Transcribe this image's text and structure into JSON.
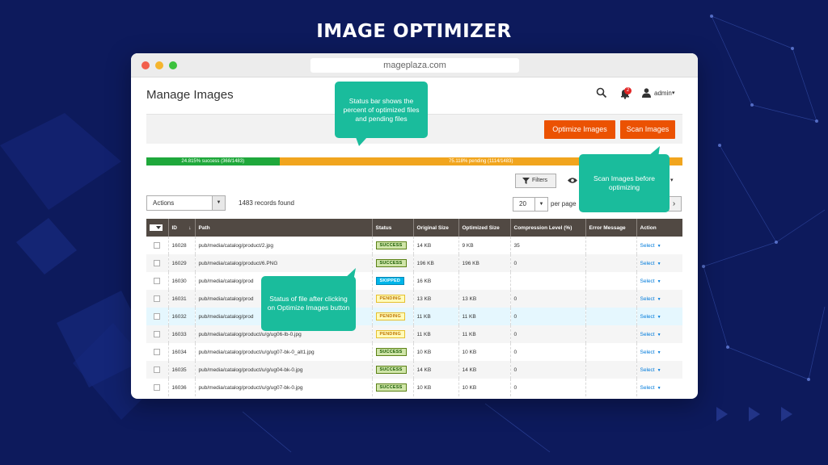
{
  "banner": {
    "title": "IMAGE OPTIMIZER"
  },
  "browser": {
    "url": "mageplaza.com"
  },
  "page": {
    "title": "Manage Images"
  },
  "header": {
    "notification_count": "2",
    "user_label": "admin"
  },
  "toolbar": {
    "optimize_label": "Optimize Images",
    "scan_label": "Scan Images"
  },
  "status_bar": {
    "success_fraction": 0.24815,
    "success_label": "24.815% success (368/1483)",
    "pending_label": "75.118% pending (1114/1483)"
  },
  "grid_controls": {
    "filters_label": "Filters",
    "actions_label": "Actions",
    "records_label": "1483 records found",
    "per_page_value": "20",
    "per_page_label": "per page"
  },
  "table": {
    "headers": [
      "ID",
      "Path",
      "Status",
      "Original Size",
      "Optimized Size",
      "Compression Level (%)",
      "Error Message",
      "Action"
    ],
    "rows": [
      {
        "id": "16028",
        "path": "pub/media/catalog/product/2.jpg",
        "status": "SUCCESS",
        "original": "14 KB",
        "optimized": "9 KB",
        "compression": "35",
        "error": "",
        "action": "Select"
      },
      {
        "id": "16029",
        "path": "pub/media/catalog/product/6.PNG",
        "status": "SUCCESS",
        "original": "196 KB",
        "optimized": "196 KB",
        "compression": "0",
        "error": "",
        "action": "Select"
      },
      {
        "id": "16030",
        "path": "pub/media/catalog/prod",
        "status": "SKIPPED",
        "original": "16 KB",
        "optimized": "",
        "compression": "",
        "error": "",
        "action": "Select"
      },
      {
        "id": "16031",
        "path": "pub/media/catalog/prod",
        "status": "PENDING",
        "original": "13 KB",
        "optimized": "13 KB",
        "compression": "0",
        "error": "",
        "action": "Select"
      },
      {
        "id": "16032",
        "path": "pub/media/catalog/prod",
        "status": "PENDING",
        "original": "11 KB",
        "optimized": "11 KB",
        "compression": "0",
        "error": "",
        "action": "Select"
      },
      {
        "id": "16033",
        "path": "pub/media/catalog/product/u/g/ug06-lb-0.jpg",
        "status": "PENDING",
        "original": "11 KB",
        "optimized": "11 KB",
        "compression": "0",
        "error": "",
        "action": "Select"
      },
      {
        "id": "16034",
        "path": "pub/media/catalog/product/u/g/ug07-bk-0_alt1.jpg",
        "status": "SUCCESS",
        "original": "10 KB",
        "optimized": "10 KB",
        "compression": "0",
        "error": "",
        "action": "Select"
      },
      {
        "id": "16035",
        "path": "pub/media/catalog/product/u/g/ug04-bk-0.jpg",
        "status": "SUCCESS",
        "original": "14 KB",
        "optimized": "14 KB",
        "compression": "0",
        "error": "",
        "action": "Select"
      },
      {
        "id": "16036",
        "path": "pub/media/catalog/product/u/g/ug07-bk-0.jpg",
        "status": "SUCCESS",
        "original": "10 KB",
        "optimized": "10 KB",
        "compression": "0",
        "error": "",
        "action": "Select"
      }
    ]
  },
  "callouts": {
    "status_bar": "Status bar shows the percent of optimized files and pending files",
    "scan": "Scan Images before optimizing",
    "file_status": "Status of file after clicking on Optimize Images button"
  },
  "colors": {
    "accent_orange": "#eb5202",
    "success_green": "#1fa83b",
    "pending_orange": "#f1a51e",
    "callout_teal": "#1abc9c",
    "grid_header": "#514943",
    "background": "#0d1a5c"
  }
}
